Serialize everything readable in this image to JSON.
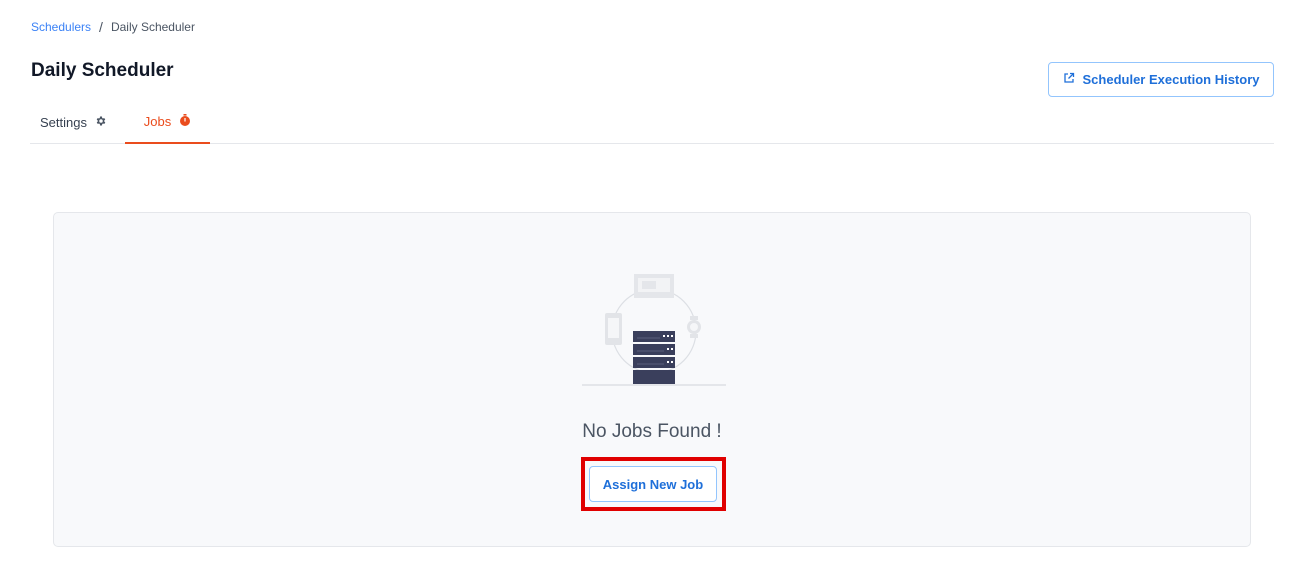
{
  "breadcrumb": {
    "parent": "Schedulers",
    "separator": "/",
    "current": "Daily Scheduler"
  },
  "page": {
    "title": "Daily Scheduler"
  },
  "header": {
    "history_button_label": "Scheduler Execution History",
    "history_icon": "external-link-icon"
  },
  "tabs": [
    {
      "label": "Settings",
      "icon": "gear-icon",
      "active": false
    },
    {
      "label": "Jobs",
      "icon": "stopwatch-icon",
      "active": true
    }
  ],
  "empty_state": {
    "message": "No Jobs Found !",
    "action_label": "Assign New Job"
  },
  "colors": {
    "accent": "#ea4c1d",
    "link": "#3b82f6",
    "button_text": "#1e6fd9",
    "highlight": "#e00000"
  }
}
